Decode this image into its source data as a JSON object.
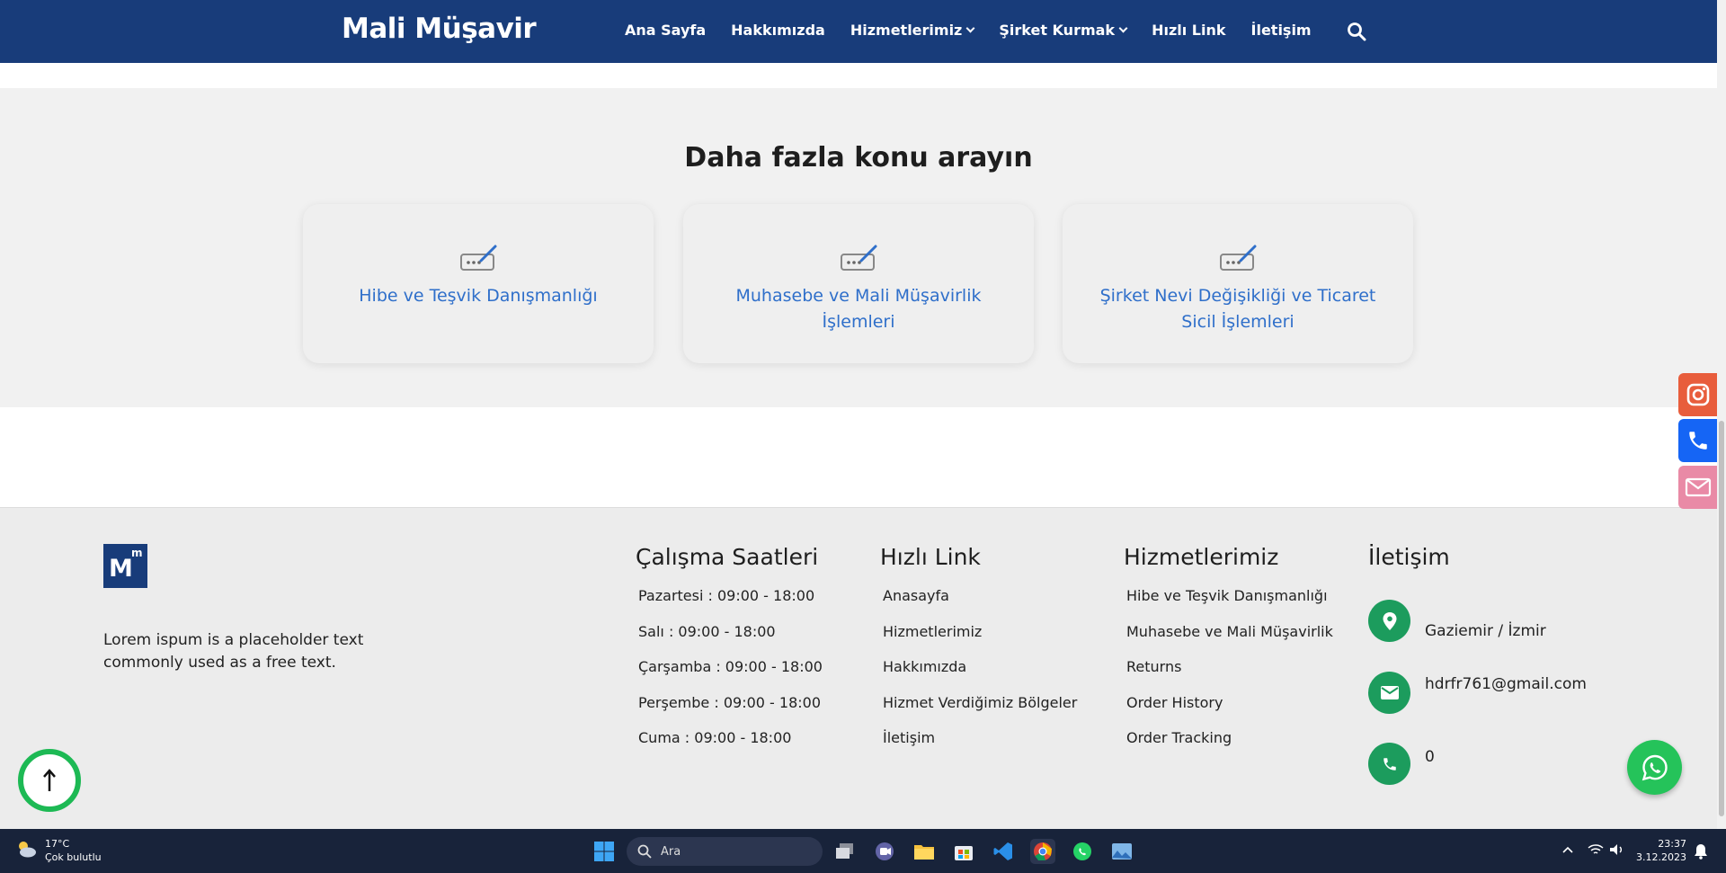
{
  "nav": {
    "brand": "Mali Müşavir",
    "items": [
      {
        "label": "Ana Sayfa",
        "dropdown": false
      },
      {
        "label": "Hakkımızda",
        "dropdown": false
      },
      {
        "label": "Hizmetlerimiz",
        "dropdown": true
      },
      {
        "label": "Şirket Kurmak",
        "dropdown": true
      },
      {
        "label": "Hızlı Link",
        "dropdown": false
      },
      {
        "label": "İletişim",
        "dropdown": false
      }
    ]
  },
  "topics": {
    "title": "Daha fazla konu arayın",
    "cards": [
      {
        "label": "Hibe ve Teşvik Danışmanlığı"
      },
      {
        "label": "Muhasebe ve Mali Müşavirlik İşlemleri"
      },
      {
        "label": "Şirket Nevi Değişikliği ve Ticaret Sicil İşlemleri"
      }
    ]
  },
  "footer": {
    "logo_text": "M",
    "logo_sup": "m",
    "description": "Lorem ispum is a placeholder text commonly used as a free text.",
    "hours": {
      "title": "Çalışma Saatleri",
      "items": [
        "Pazartesi : 09:00 - 18:00",
        "Salı : 09:00 - 18:00",
        "Çarşamba : 09:00 - 18:00",
        "Perşembe : 09:00 - 18:00",
        "Cuma : 09:00 - 18:00"
      ]
    },
    "quick": {
      "title": "Hızlı Link",
      "items": [
        "Anasayfa",
        "Hizmetlerimiz",
        "Hakkımızda",
        "Hizmet Verdiğimiz Bölgeler",
        "İletişim"
      ]
    },
    "services": {
      "title": "Hizmetlerimiz",
      "items": [
        "Hibe ve Teşvik Danışmanlığı",
        "Muhasebe ve Mali Müşavirlik",
        "Returns",
        "Order History",
        "Order Tracking"
      ]
    },
    "contact": {
      "title": "İletişim",
      "address": "Gaziemir / İzmir",
      "email": "hdrfr761@gmail.com",
      "phone": "0"
    }
  },
  "taskbar": {
    "temp": "17°C",
    "weather": "Çok bulutlu",
    "search_placeholder": "Ara",
    "time": "23:37",
    "date": "3.12.2023"
  },
  "colors": {
    "nav_bg": "#183c7a",
    "link_blue": "#2f6fca",
    "contact_green": "#1c9c5d",
    "instagram": "#e4405f",
    "phone_blue": "#1565f5",
    "mail_pink": "#e98aa6",
    "whatsapp": "#25c35a"
  }
}
